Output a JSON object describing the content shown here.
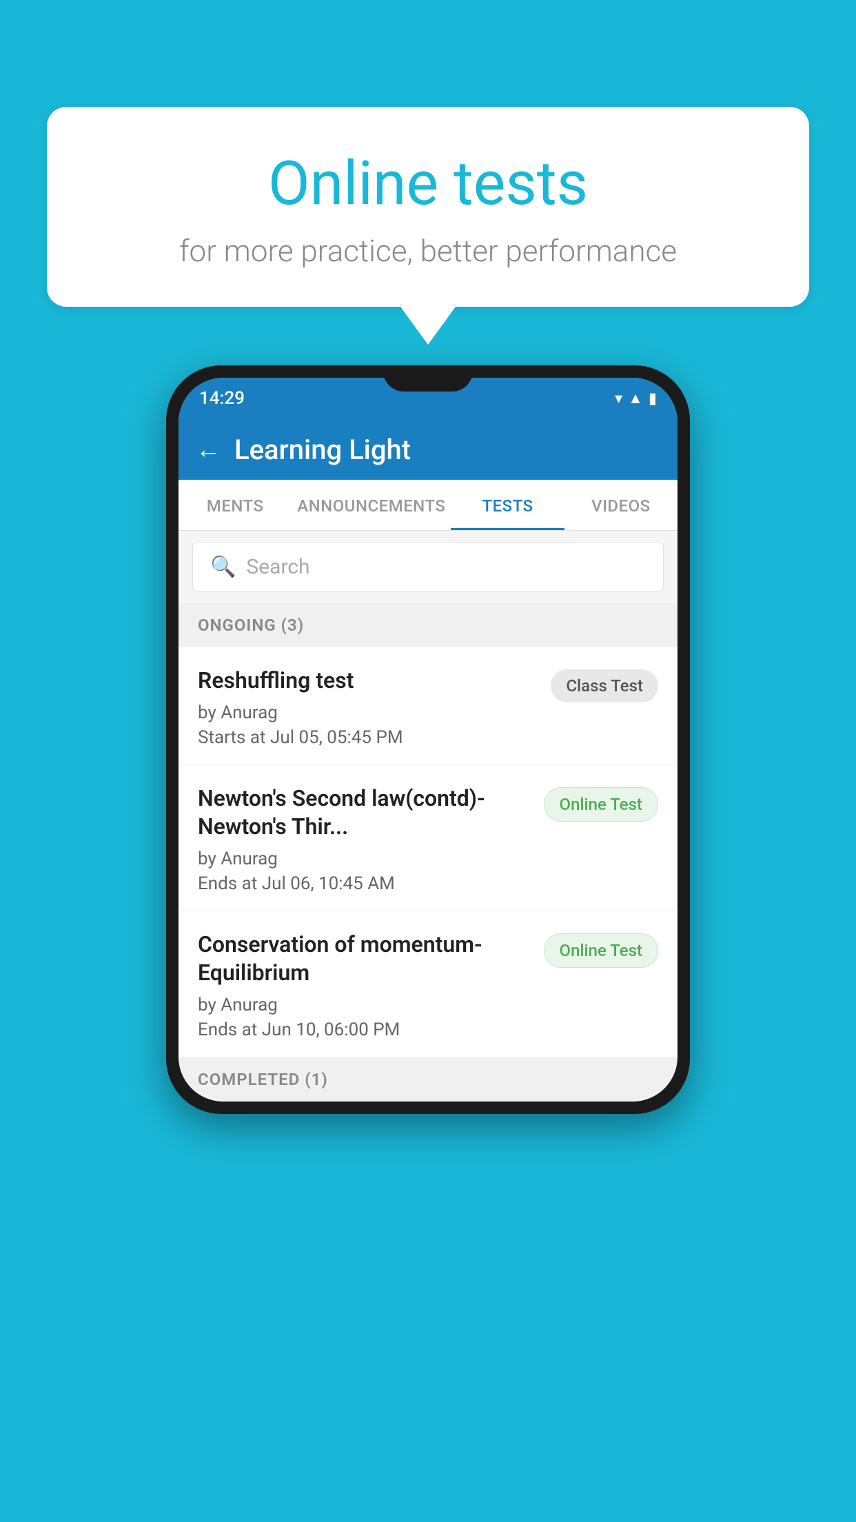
{
  "background_color": "#1ab8d8",
  "speech_bubble": {
    "title": "Online tests",
    "subtitle": "for more practice, better performance"
  },
  "phone": {
    "status_bar": {
      "time": "14:29",
      "icons": [
        "wifi",
        "signal",
        "battery"
      ]
    },
    "header": {
      "back_label": "←",
      "title": "Learning Light"
    },
    "tabs": [
      {
        "label": "MENTS",
        "active": false
      },
      {
        "label": "ANNOUNCEMENTS",
        "active": false
      },
      {
        "label": "TESTS",
        "active": true
      },
      {
        "label": "VIDEOS",
        "active": false
      }
    ],
    "search": {
      "placeholder": "Search"
    },
    "sections": [
      {
        "title": "ONGOING (3)",
        "items": [
          {
            "title": "Reshuffling test",
            "author": "by Anurag",
            "time_label": "Starts at",
            "time": "Jul 05, 05:45 PM",
            "badge": "Class Test",
            "badge_type": "class"
          },
          {
            "title": "Newton's Second law(contd)-Newton's Thir...",
            "author": "by Anurag",
            "time_label": "Ends at",
            "time": "Jul 06, 10:45 AM",
            "badge": "Online Test",
            "badge_type": "online"
          },
          {
            "title": "Conservation of momentum-Equilibrium",
            "author": "by Anurag",
            "time_label": "Ends at",
            "time": "Jun 10, 06:00 PM",
            "badge": "Online Test",
            "badge_type": "online"
          }
        ]
      }
    ],
    "completed_label": "COMPLETED (1)"
  }
}
